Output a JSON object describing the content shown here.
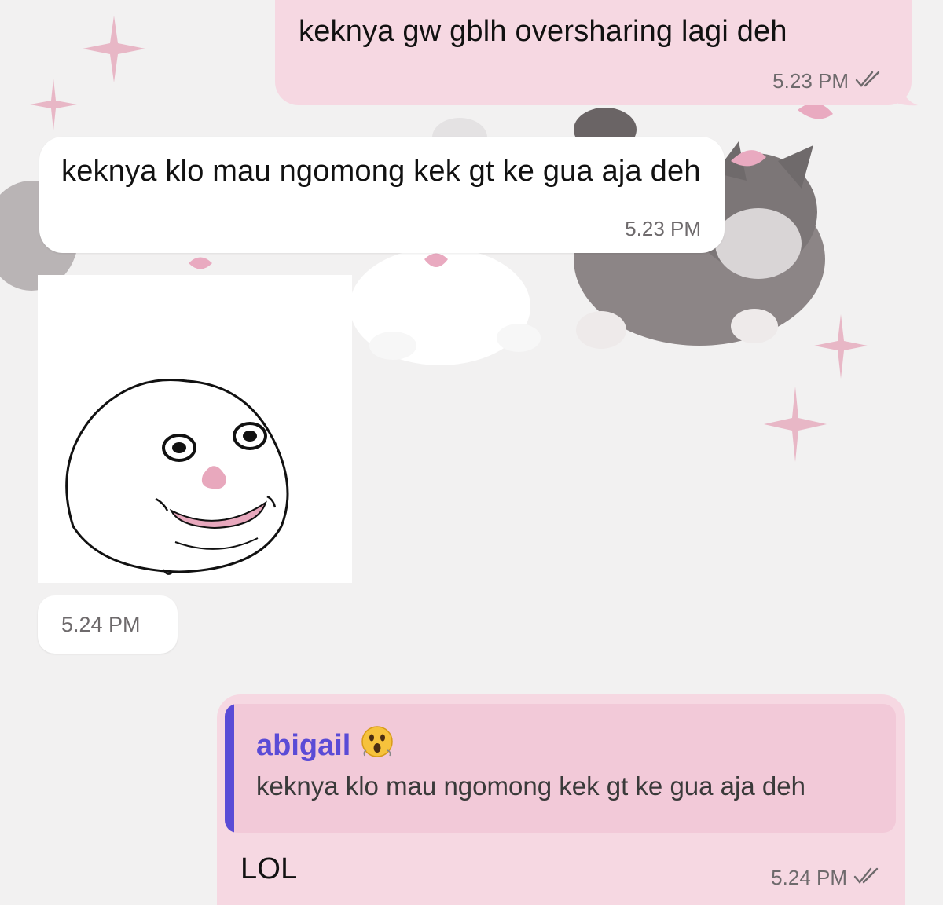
{
  "chat": {
    "messages": [
      {
        "direction": "outgoing",
        "text": "keknya gw gblh oversharing lagi deh",
        "time": "5.23 PM",
        "status": "read"
      },
      {
        "direction": "incoming",
        "text": "keknya klo mau ngomong kek gt ke gua aja deh",
        "time": "5.23 PM"
      },
      {
        "direction": "incoming",
        "type": "sticker",
        "sticker": "face-sticker",
        "time": "5.24 PM"
      },
      {
        "direction": "outgoing",
        "reply_to": {
          "name": "abigail",
          "emoji": "astonished-face",
          "text": "keknya klo mau ngomong kek gt ke gua aja deh"
        },
        "text": "LOL",
        "time": "5.24 PM",
        "status": "read"
      }
    ]
  },
  "colors": {
    "outgoing_bubble": "#f6d8e2",
    "incoming_bubble": "#ffffff",
    "reply_accent": "#5a4bd6",
    "background": "#f2f1f1"
  },
  "icons": {
    "read_status": "double-check-icon",
    "wallpaper": "kittens-with-bows-and-sparkles"
  }
}
